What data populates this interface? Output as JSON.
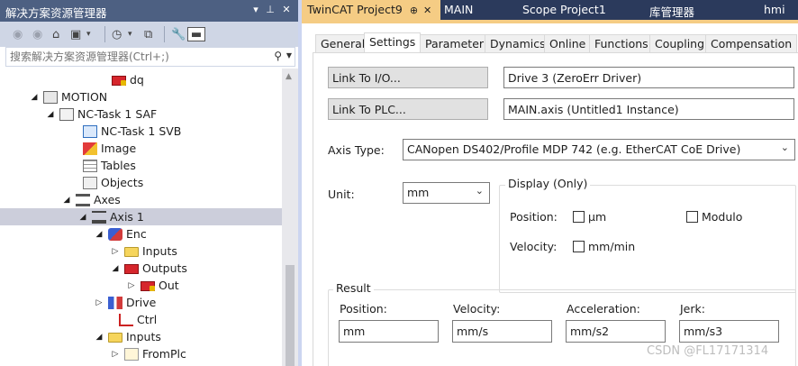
{
  "solution_explorer": {
    "title": "解决方案资源管理器",
    "search_placeholder": "搜索解决方案资源管理器(Ctrl+;)",
    "tree": [
      {
        "label": "dq",
        "icon": "red-output-icon"
      },
      {
        "label": "MOTION",
        "icon": "motion-icon"
      },
      {
        "label": "NC-Task 1 SAF",
        "icon": "task-icon"
      },
      {
        "label": "NC-Task 1 SVB",
        "icon": "svb-icon"
      },
      {
        "label": "Image",
        "icon": "image-icon"
      },
      {
        "label": "Tables",
        "icon": "tables-icon"
      },
      {
        "label": "Objects",
        "icon": "objects-icon"
      },
      {
        "label": "Axes",
        "icon": "axes-icon"
      },
      {
        "label": "Axis 1",
        "icon": "axis-icon"
      },
      {
        "label": "Enc",
        "icon": "encoder-icon"
      },
      {
        "label": "Inputs",
        "icon": "yellow-folder-icon"
      },
      {
        "label": "Outputs",
        "icon": "red-folder-icon"
      },
      {
        "label": "Out",
        "icon": "red-output-icon"
      },
      {
        "label": "Drive",
        "icon": "drive-icon"
      },
      {
        "label": "Ctrl",
        "icon": "ctrl-icon"
      },
      {
        "label": "Inputs",
        "icon": "yellow-folder-icon"
      },
      {
        "label": "FromPlc",
        "icon": "fromplc-icon"
      }
    ]
  },
  "doc_tabs": [
    {
      "label": "TwinCAT Project9",
      "pin": "⊕",
      "close": "✕"
    },
    {
      "label": "MAIN"
    },
    {
      "label": "Scope Project1"
    },
    {
      "label": "库管理器"
    },
    {
      "label": "hmi"
    }
  ],
  "prop_tabs": [
    "General",
    "Settings",
    "Parameter",
    "Dynamics",
    "Online",
    "Functions",
    "Coupling",
    "Compensation"
  ],
  "settings": {
    "link_io_button": "Link To I/O...",
    "link_io_value": "Drive 3 (ZeroErr Driver)",
    "link_plc_button": "Link To PLC...",
    "link_plc_value": "MAIN.axis (Untitled1 Instance)",
    "axis_type_label": "Axis Type:",
    "axis_type_value": "CANopen DS402/Profile MDP 742 (e.g. EtherCAT CoE Drive)",
    "unit_label": "Unit:",
    "unit_value": "mm",
    "display_group": "Display (Only)",
    "position_label": "Position:",
    "position_unit": "μm",
    "modulo_label": "Modulo",
    "velocity_label": "Velocity:",
    "velocity_unit": "mm/min",
    "result_group": "Result",
    "result_position_label": "Position:",
    "result_position_value": "mm",
    "result_velocity_label": "Velocity:",
    "result_velocity_value": "mm/s",
    "result_acceleration_label": "Acceleration:",
    "result_acceleration_value": "mm/s2",
    "result_jerk_label": "Jerk:",
    "result_jerk_value": "mm/s3"
  },
  "watermark": "CSDN @FL17171314"
}
